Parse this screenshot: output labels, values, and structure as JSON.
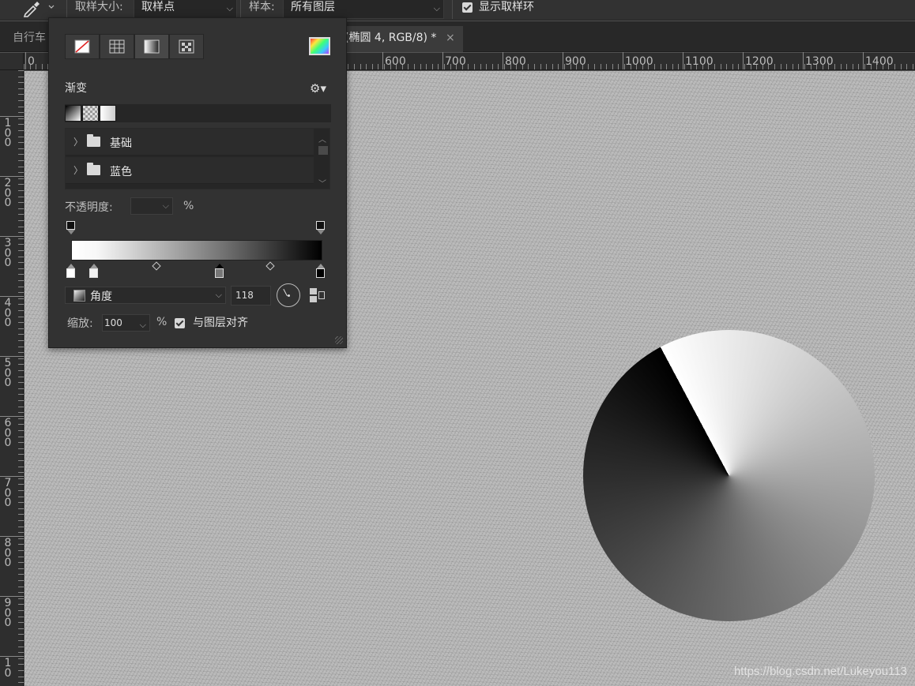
{
  "options_bar": {
    "tool_icon": "eyedropper-icon",
    "sample_size_label": "取样大小:",
    "sample_size_value": "取样点",
    "sample_label": "样本:",
    "sample_value": "所有图层",
    "show_ring_label": "显示取样环",
    "show_ring_checked": true
  },
  "tabs": {
    "left_tab_label": "自行车",
    "active_tab_label": "(椭圆 4, RGB/8) *",
    "close_symbol": "×"
  },
  "rulers": {
    "horizontal_labels": [
      "0",
      "600",
      "700",
      "800",
      "900",
      "1000",
      "1100",
      "1200",
      "1300",
      "1400"
    ],
    "vertical_labels": [
      "100",
      "200",
      "300",
      "400",
      "500",
      "600",
      "700",
      "800",
      "900",
      "10"
    ]
  },
  "canvas": {
    "watermark": "https://blog.csdn.net/Lukeyou113",
    "background_color": "#b4b4b4"
  },
  "gradient_panel": {
    "mode_buttons": [
      "none-icon",
      "grid-icon",
      "gradient-icon",
      "pattern-icon"
    ],
    "selected_mode_index": 2,
    "section_title": "渐变",
    "folders": [
      {
        "label": "基础"
      },
      {
        "label": "蓝色"
      }
    ],
    "opacity_label": "不透明度:",
    "opacity_value": "",
    "opacity_unit": "%",
    "gradient_type": "角度",
    "angle_value": "118",
    "scale_label": "缩放:",
    "scale_value": "100",
    "scale_unit": "%",
    "align_with_layer_label": "与图层对齐",
    "align_with_layer_checked": true
  }
}
